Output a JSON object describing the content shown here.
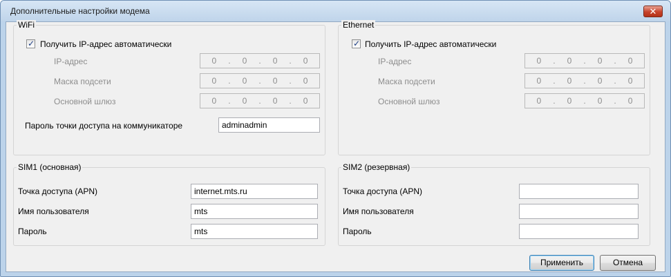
{
  "window": {
    "title": "Дополнительные настройки модема",
    "close_glyph": "✕"
  },
  "wifi": {
    "group_title": "WiFi",
    "auto_ip_label": "Получить IP-адрес автоматически",
    "auto_ip_checked": true,
    "ip_label": "IP-адрес",
    "ip_value": [
      "0",
      "0",
      "0",
      "0"
    ],
    "mask_label": "Маска подсети",
    "mask_value": [
      "0",
      "0",
      "0",
      "0"
    ],
    "gateway_label": "Основной шлюз",
    "gateway_value": [
      "0",
      "0",
      "0",
      "0"
    ],
    "ap_password_label": "Пароль точки доступа на коммуникаторе",
    "ap_password_value": "adminadmin"
  },
  "ethernet": {
    "group_title": "Ethernet",
    "auto_ip_label": "Получить IP-адрес автоматически",
    "auto_ip_checked": true,
    "ip_label": "IP-адрес",
    "ip_value": [
      "0",
      "0",
      "0",
      "0"
    ],
    "mask_label": "Маска подсети",
    "mask_value": [
      "0",
      "0",
      "0",
      "0"
    ],
    "gateway_label": "Основной шлюз",
    "gateway_value": [
      "0",
      "0",
      "0",
      "0"
    ]
  },
  "sim1": {
    "group_title": "SIM1 (основная)",
    "apn_label": "Точка доступа (APN)",
    "apn_value": "internet.mts.ru",
    "user_label": "Имя пользователя",
    "user_value": "mts",
    "password_label": "Пароль",
    "password_value": "mts"
  },
  "sim2": {
    "group_title": "SIM2 (резервная)",
    "apn_label": "Точка доступа (APN)",
    "apn_value": "",
    "user_label": "Имя пользователя",
    "user_value": "",
    "password_label": "Пароль",
    "password_value": ""
  },
  "buttons": {
    "apply_label": "Применить",
    "cancel_label": "Отмена"
  },
  "ip_separator": ".",
  "checkmark_glyph": "✓"
}
